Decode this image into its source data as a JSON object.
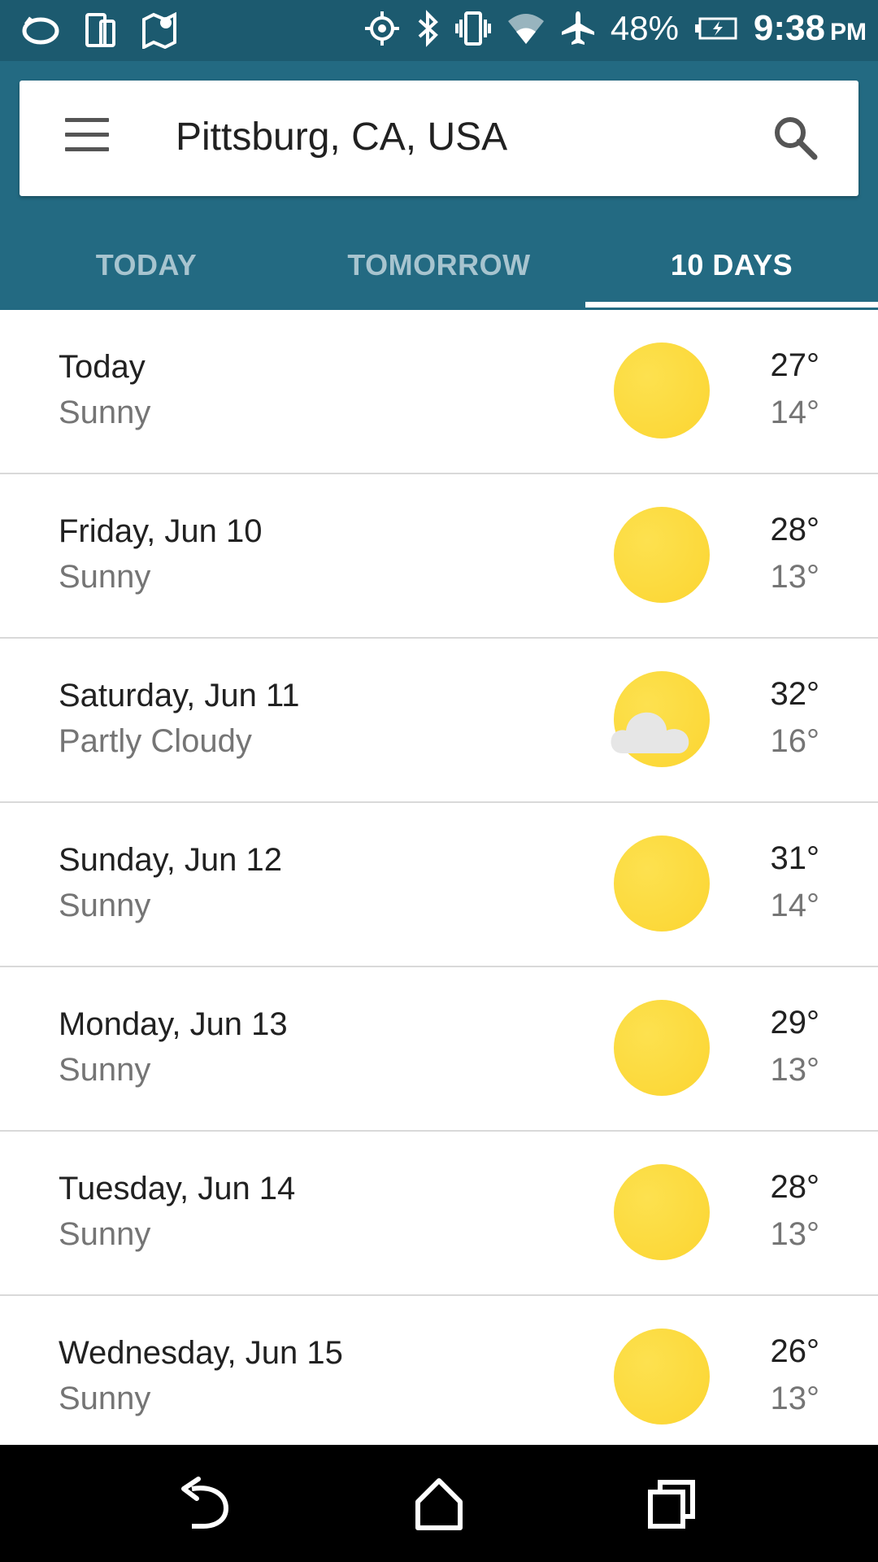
{
  "status_bar": {
    "battery": "48%",
    "time": "9:38",
    "ampm": "PM",
    "icons": [
      "sync-icon",
      "phone-tablet-icon",
      "maps-icon",
      "location-target-icon",
      "bluetooth-icon",
      "vibrate-icon",
      "wifi-icon",
      "airplane-icon",
      "battery-charging-icon"
    ]
  },
  "search": {
    "location": "Pittsburg, CA, USA"
  },
  "tabs": [
    {
      "label": "TODAY",
      "active": false
    },
    {
      "label": "TOMORROW",
      "active": false
    },
    {
      "label": "10 DAYS",
      "active": true
    }
  ],
  "forecast": [
    {
      "day": "Today",
      "condition": "Sunny",
      "high": "27°",
      "low": "14°",
      "icon": "sun-icon"
    },
    {
      "day": "Friday, Jun 10",
      "condition": "Sunny",
      "high": "28°",
      "low": "13°",
      "icon": "sun-icon"
    },
    {
      "day": "Saturday, Jun 11",
      "condition": "Partly Cloudy",
      "high": "32°",
      "low": "16°",
      "icon": "partly-cloudy-icon"
    },
    {
      "day": "Sunday, Jun 12",
      "condition": "Sunny",
      "high": "31°",
      "low": "14°",
      "icon": "sun-icon"
    },
    {
      "day": "Monday, Jun 13",
      "condition": "Sunny",
      "high": "29°",
      "low": "13°",
      "icon": "sun-icon"
    },
    {
      "day": "Tuesday, Jun 14",
      "condition": "Sunny",
      "high": "28°",
      "low": "13°",
      "icon": "sun-icon"
    },
    {
      "day": "Wednesday, Jun 15",
      "condition": "Sunny",
      "high": "26°",
      "low": "13°",
      "icon": "sun-icon"
    }
  ],
  "colors": {
    "status_bar": "#1c5a6f",
    "app_bar": "#236a82",
    "sun": "#fbd531",
    "inactive_tab": "#a7c4cf"
  },
  "nav": {
    "icons": [
      "back-icon",
      "home-icon",
      "recents-icon"
    ]
  }
}
